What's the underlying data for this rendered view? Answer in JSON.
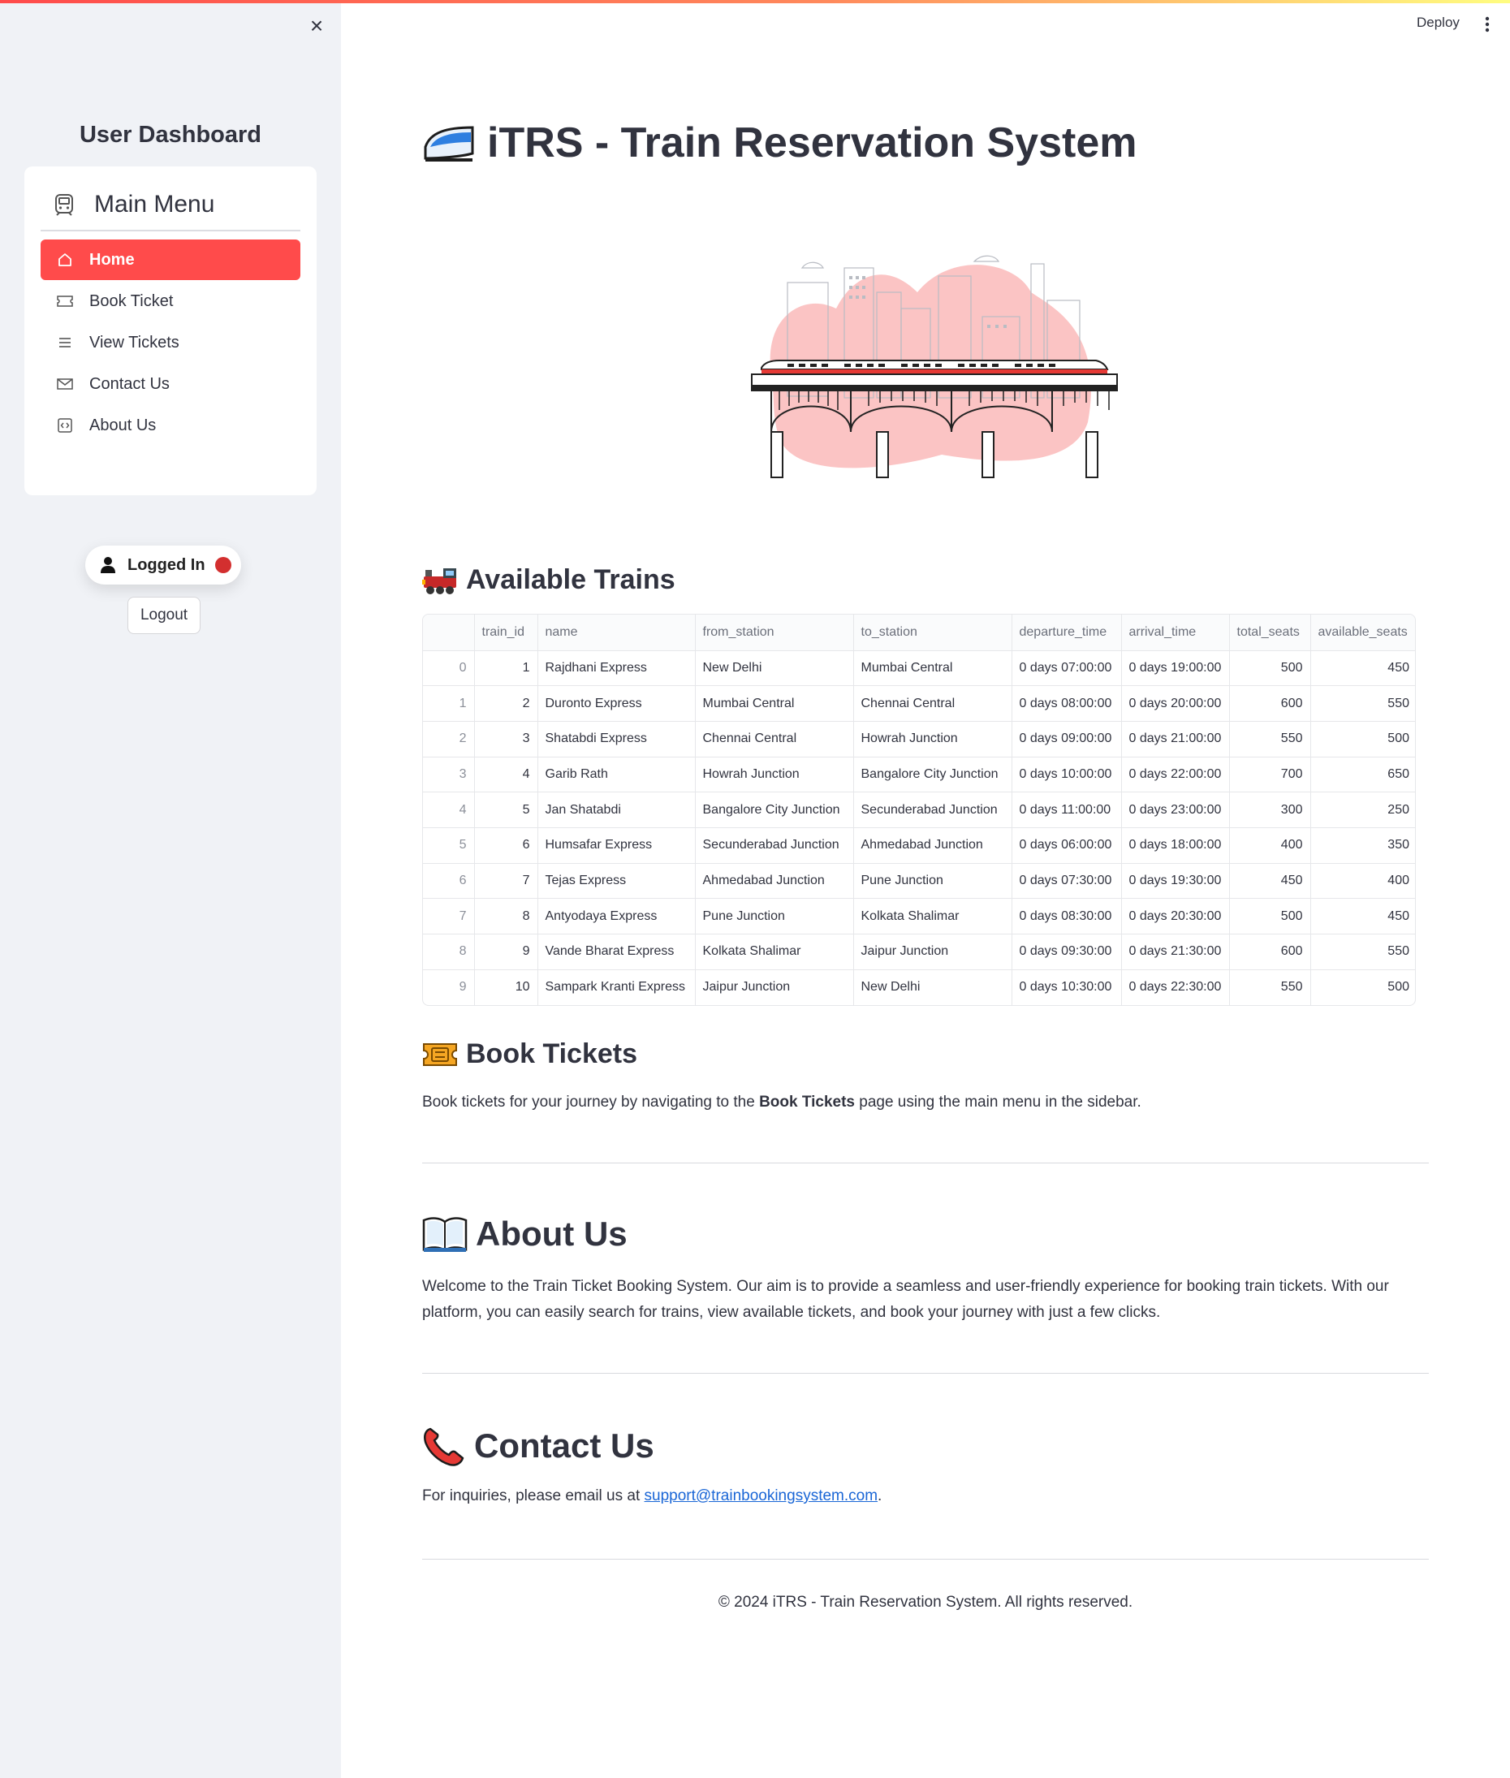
{
  "sidebar": {
    "close_label": "×",
    "title": "User Dashboard",
    "menu_title": "Main Menu",
    "items": [
      {
        "label": "Home",
        "icon": "house-icon"
      },
      {
        "label": "Book Ticket",
        "icon": "ticket-icon"
      },
      {
        "label": "View Tickets",
        "icon": "list-icon"
      },
      {
        "label": "Contact Us",
        "icon": "envelope-icon"
      },
      {
        "label": "About Us",
        "icon": "code-square-icon"
      }
    ],
    "status_label": "Logged In",
    "logout_label": "Logout"
  },
  "header": {
    "deploy_label": "Deploy"
  },
  "main": {
    "title": "iTRS - Train Reservation System",
    "available_trains_heading": "Available Trains",
    "table": {
      "columns": [
        "",
        "train_id",
        "name",
        "from_station",
        "to_station",
        "departure_time",
        "arrival_time",
        "total_seats",
        "available_seats"
      ],
      "rows": [
        [
          "0",
          "1",
          "Rajdhani Express",
          "New Delhi",
          "Mumbai Central",
          "0 days 07:00:00",
          "0 days 19:00:00",
          "500",
          "450"
        ],
        [
          "1",
          "2",
          "Duronto Express",
          "Mumbai Central",
          "Chennai Central",
          "0 days 08:00:00",
          "0 days 20:00:00",
          "600",
          "550"
        ],
        [
          "2",
          "3",
          "Shatabdi Express",
          "Chennai Central",
          "Howrah Junction",
          "0 days 09:00:00",
          "0 days 21:00:00",
          "550",
          "500"
        ],
        [
          "3",
          "4",
          "Garib Rath",
          "Howrah Junction",
          "Bangalore City Junction",
          "0 days 10:00:00",
          "0 days 22:00:00",
          "700",
          "650"
        ],
        [
          "4",
          "5",
          "Jan Shatabdi",
          "Bangalore City Junction",
          "Secunderabad Junction",
          "0 days 11:00:00",
          "0 days 23:00:00",
          "300",
          "250"
        ],
        [
          "5",
          "6",
          "Humsafar Express",
          "Secunderabad Junction",
          "Ahmedabad Junction",
          "0 days 06:00:00",
          "0 days 18:00:00",
          "400",
          "350"
        ],
        [
          "6",
          "7",
          "Tejas Express",
          "Ahmedabad Junction",
          "Pune Junction",
          "0 days 07:30:00",
          "0 days 19:30:00",
          "450",
          "400"
        ],
        [
          "7",
          "8",
          "Antyodaya Express",
          "Pune Junction",
          "Kolkata Shalimar",
          "0 days 08:30:00",
          "0 days 20:30:00",
          "500",
          "450"
        ],
        [
          "8",
          "9",
          "Vande Bharat Express",
          "Kolkata Shalimar",
          "Jaipur Junction",
          "0 days 09:30:00",
          "0 days 21:30:00",
          "600",
          "550"
        ],
        [
          "9",
          "10",
          "Sampark Kranti Express",
          "Jaipur Junction",
          "New Delhi",
          "0 days 10:30:00",
          "0 days 22:30:00",
          "550",
          "500"
        ]
      ]
    },
    "book_heading": "Book Tickets",
    "book_text_before": "Book tickets for your journey by navigating to the ",
    "book_text_bold": "Book Tickets",
    "book_text_after": " page using the main menu in the sidebar.",
    "about_heading": "About Us",
    "about_text": "Welcome to the Train Ticket Booking System. Our aim is to provide a seamless and user-friendly experience for booking train tickets. With our platform, you can easily search for trains, view available tickets, and book your journey with just a few clicks.",
    "contact_heading": "Contact Us",
    "contact_text_before": "For inquiries, please email us at ",
    "contact_email": "support@trainbookingsystem.com",
    "contact_text_after": ".",
    "footer": "© 2024 iTRS - Train Reservation System. All rights reserved."
  },
  "colors": {
    "accent": "#ff4b4b",
    "sidebar_bg": "#f0f2f6",
    "status_dot": "#d32f2f",
    "link": "#1a66d6"
  }
}
